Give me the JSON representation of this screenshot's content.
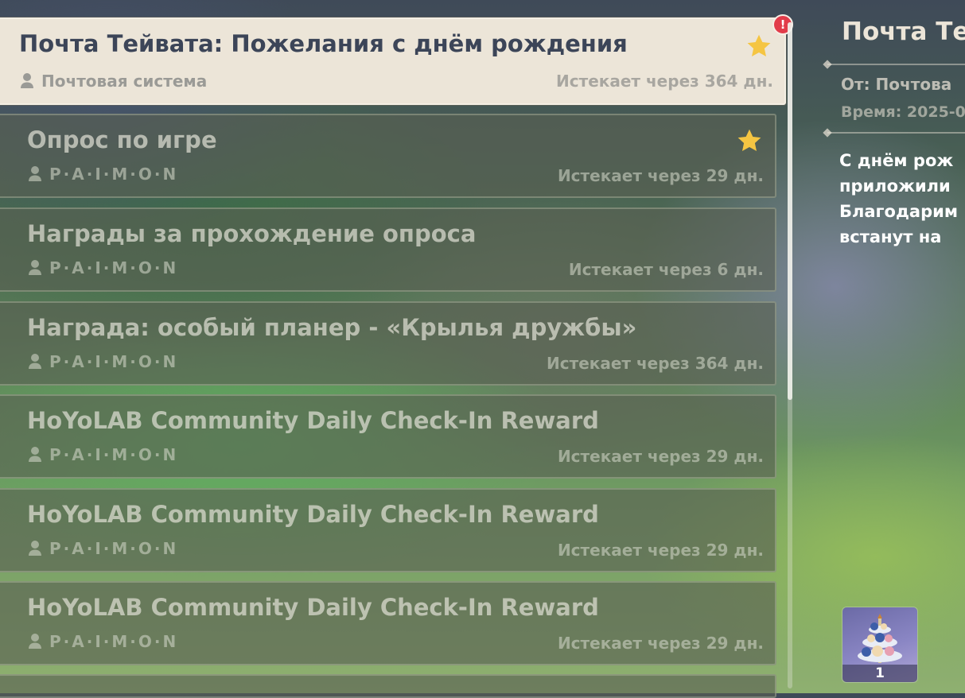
{
  "mail_list": [
    {
      "title": "Почта Тейвата: Пожелания с днём рождения",
      "sender": "Почтовая система",
      "expiry": "Истекает через 364 дн.",
      "starred": true,
      "selected": true
    },
    {
      "title": "Опрос по игре",
      "sender": "P·A·I·M·O·N",
      "expiry": "Истекает через 29 дн.",
      "starred": true,
      "selected": false
    },
    {
      "title": "Награды за прохождение опроса",
      "sender": "P·A·I·M·O·N",
      "expiry": "Истекает через 6 дн.",
      "starred": false,
      "selected": false
    },
    {
      "title": "Награда: особый планер - «Крылья дружбы»",
      "sender": "P·A·I·M·O·N",
      "expiry": "Истекает через 364 дн.",
      "starred": false,
      "selected": false
    },
    {
      "title": "HoYoLAB Community Daily Check-In Reward",
      "sender": "P·A·I·M·O·N",
      "expiry": "Истекает через 29 дн.",
      "starred": false,
      "selected": false
    },
    {
      "title": "HoYoLAB Community Daily Check-In Reward",
      "sender": "P·A·I·M·O·N",
      "expiry": "Истекает через 29 дн.",
      "starred": false,
      "selected": false
    },
    {
      "title": "HoYoLAB Community Daily Check-In Reward",
      "sender": "P·A·I·M·O·N",
      "expiry": "Истекает через 29 дн.",
      "starred": false,
      "selected": false
    }
  ],
  "badge": {
    "text": "!"
  },
  "detail": {
    "title": "Почта Те",
    "from": "От: Почтова",
    "time": "Время: 2025-0",
    "body_lines": [
      "С днём рож",
      "приложили",
      "Благодарим",
      "встанут на"
    ]
  },
  "attachment": {
    "count": "1"
  },
  "colors": {
    "star": "#f5c542",
    "badge": "#e23c4a",
    "selected_card": "#ece5d8"
  }
}
